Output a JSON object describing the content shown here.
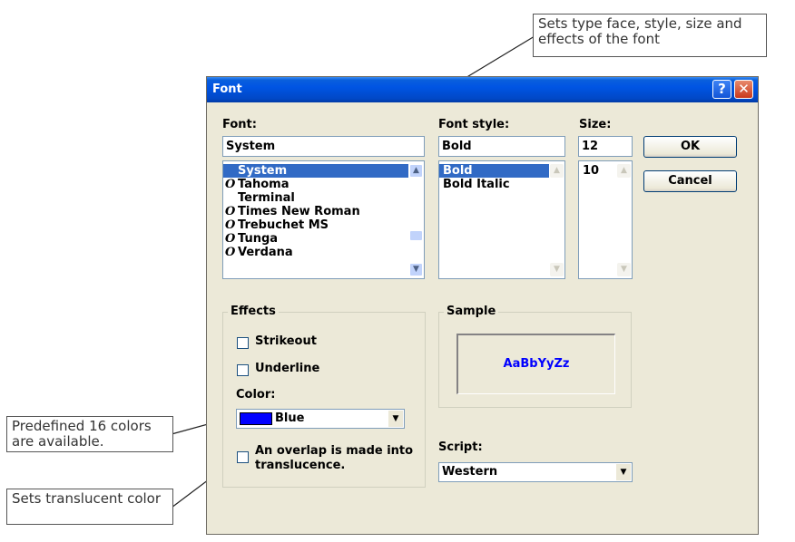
{
  "callouts": {
    "top": "Sets type face, style, size and effects of the font",
    "colors": "Predefined 16 colors are available.",
    "translucent": "Sets translucent color"
  },
  "dialog": {
    "title": "Font",
    "help": "?",
    "close": "✕",
    "font_label": "Font:",
    "font_value": "System",
    "font_list": [
      "System",
      "Tahoma",
      "Terminal",
      "Times New Roman",
      "Trebuchet MS",
      "Tunga",
      "Verdana"
    ],
    "font_list_truetype": [
      false,
      true,
      false,
      true,
      true,
      true,
      true
    ],
    "font_selected": "System",
    "style_label": "Font style:",
    "style_value": "Bold",
    "style_list": [
      "Bold",
      "Bold Italic"
    ],
    "size_label": "Size:",
    "size_value": "12",
    "size_list": [
      "10"
    ],
    "ok": "OK",
    "cancel": "Cancel",
    "effects": {
      "title": "Effects",
      "strikeout": "Strikeout",
      "underline": "Underline",
      "color_label": "Color:",
      "color_value": "Blue",
      "color_swatch": "#0000ff",
      "overlap_line1": "An overlap is made into",
      "overlap_line2": "translucence."
    },
    "sample": {
      "title": "Sample",
      "text": "AaBbYyZz",
      "text_color": "#0000ff"
    },
    "script_label": "Script:",
    "script_value": "Western"
  }
}
